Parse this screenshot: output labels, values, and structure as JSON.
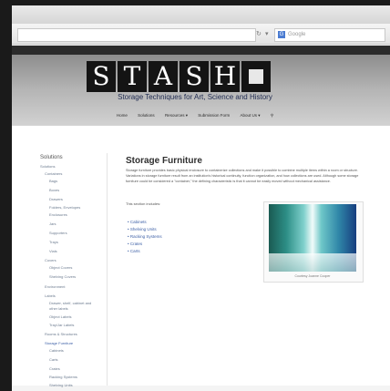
{
  "browser": {
    "search_placeholder": "Google",
    "reload_icon": "↻",
    "dropdown_icon": "▾"
  },
  "site": {
    "logo_letters": [
      "S",
      "T",
      "A",
      "S",
      "H"
    ],
    "tagline": "Storage Techniques for Art, Science and History",
    "nav": [
      "Home",
      "Solutions",
      "Resources ▾",
      "Submission Form",
      "About Us ▾"
    ],
    "search_icon": "⚲"
  },
  "sidebar": {
    "title": "Solutions",
    "items": [
      {
        "label": "Solutions"
      },
      {
        "label": "Containers"
      },
      {
        "label": "Bags"
      },
      {
        "label": "Boxes"
      },
      {
        "label": "Drawers"
      },
      {
        "label": "Folders, Envelopes"
      },
      {
        "label": "Enclosures"
      },
      {
        "label": "Jars"
      },
      {
        "label": "Supporters"
      },
      {
        "label": "Trays"
      },
      {
        "label": "Vials"
      },
      {
        "label": "Covers"
      },
      {
        "label": "Object Covers"
      },
      {
        "label": "Shelving Covers"
      },
      {
        "label": "Environment"
      },
      {
        "label": "Labels"
      },
      {
        "label": "Drawer, shelf, cabinet and other labels"
      },
      {
        "label": "Object Labels"
      },
      {
        "label": "Tray/Jar Labels"
      },
      {
        "label": "Rooms & Structures"
      },
      {
        "label": "Storage Furniture"
      },
      {
        "label": "Cabinets"
      },
      {
        "label": "Carts"
      },
      {
        "label": "Crates"
      },
      {
        "label": "Racking Systems"
      },
      {
        "label": "Shelving Units"
      }
    ]
  },
  "main": {
    "title": "Storage Furniture",
    "paragraph": "Storage furniture provides basic physical enclosure to containerize collections and make it possible to combine multiple items within a room or structure. Variations in storage furniture result from an institution's historical continuity, function organization, and how collections are used. Although some storage furniture could be considered a \"container,\" the defining characteristic is that it cannot be easily moved without mechanical assistance.",
    "includes_label": "This section includes:",
    "links": [
      "Cabinets",
      "Shelving Units",
      "Racking Systems",
      "Crates",
      "Carts"
    ],
    "image_caption": "Courtesy Joanne Cooper"
  },
  "colors": {
    "link": "#3c5fa6",
    "header_top": "#8d8d8d",
    "header_bottom": "#d2d2d2",
    "logo_box": "#141414",
    "tagline": "#1e2a50"
  }
}
